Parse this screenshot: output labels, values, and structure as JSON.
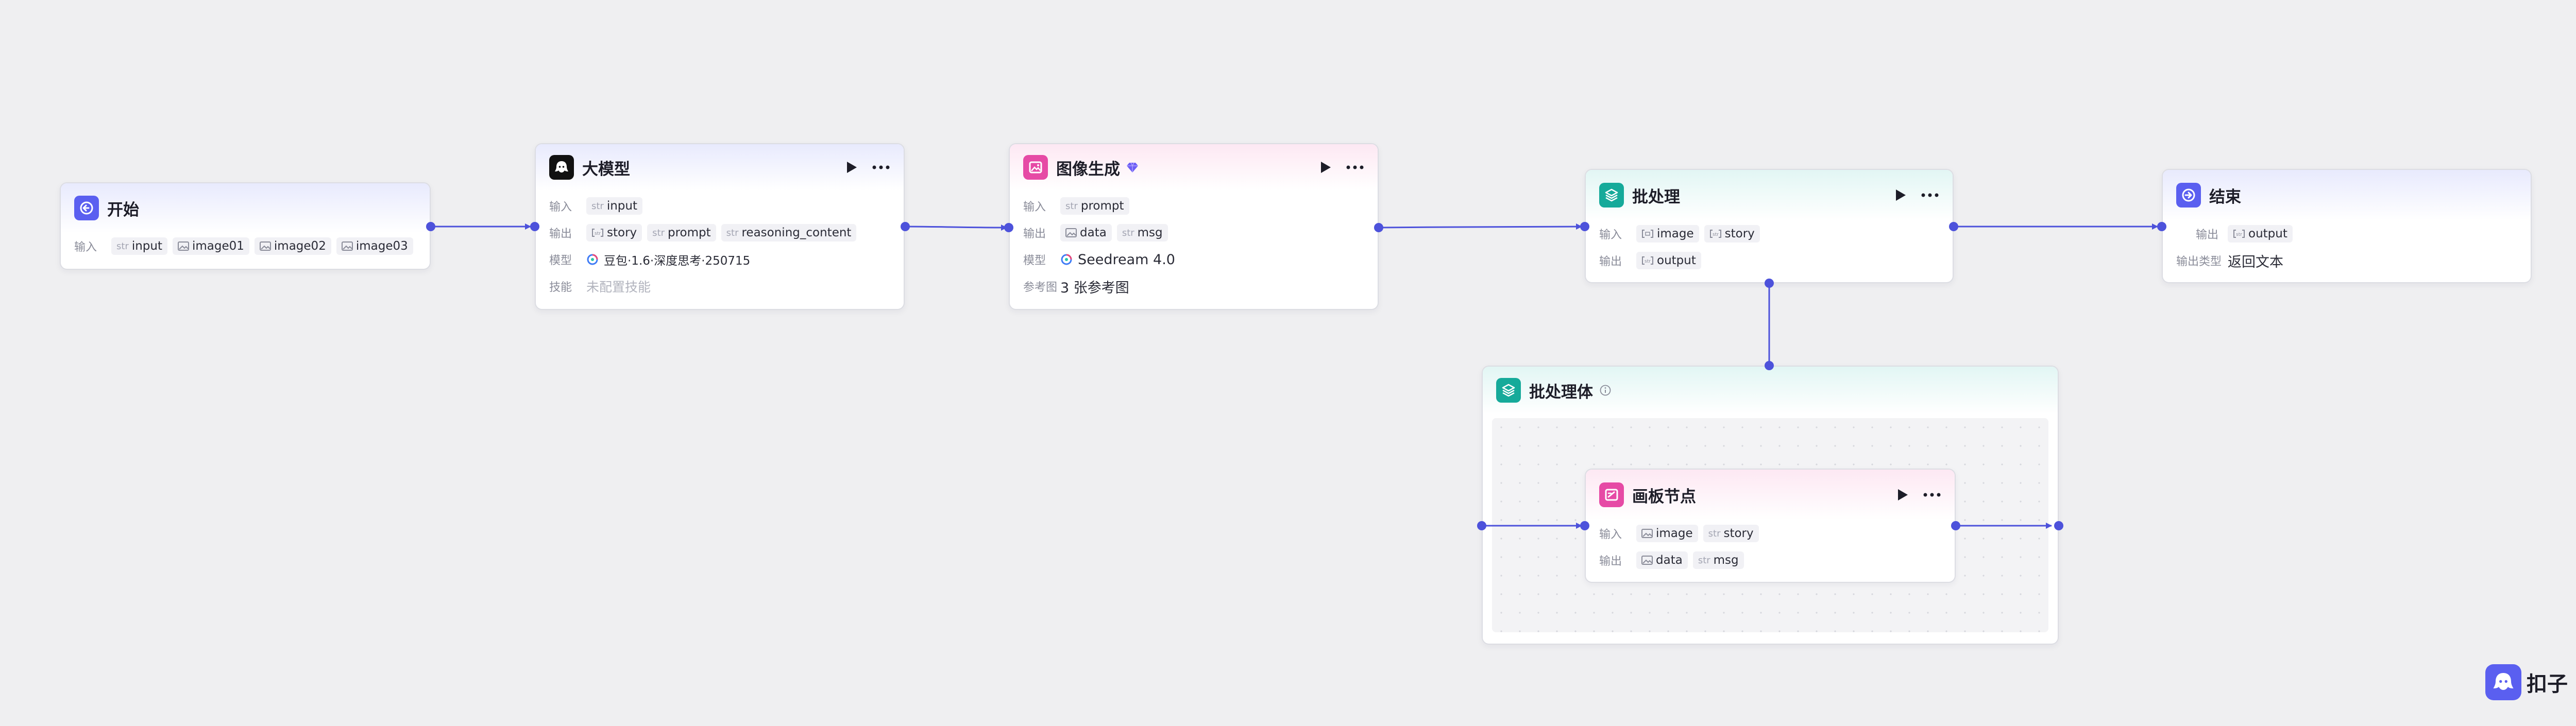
{
  "nodes": {
    "start": {
      "title": "开始",
      "input_label": "输入",
      "inputs": [
        {
          "type": "str",
          "name": "input"
        },
        {
          "type": "image",
          "name": "image01"
        },
        {
          "type": "image",
          "name": "image02"
        },
        {
          "type": "image",
          "name": "image03"
        }
      ]
    },
    "llm": {
      "title": "大模型",
      "input_label": "输入",
      "output_label": "输出",
      "model_label": "模型",
      "skill_label": "技能",
      "inputs": [
        {
          "type": "str",
          "name": "input"
        }
      ],
      "outputs": [
        {
          "type": "list",
          "name": "story"
        },
        {
          "type": "str",
          "name": "prompt"
        },
        {
          "type": "str",
          "name": "reasoning_content"
        }
      ],
      "model": "豆包·1.6·深度思考·250715",
      "skill": "未配置技能"
    },
    "image_gen": {
      "title": "图像生成",
      "input_label": "输入",
      "output_label": "输出",
      "model_label": "模型",
      "ref_label": "参考图",
      "inputs": [
        {
          "type": "str",
          "name": "prompt"
        }
      ],
      "outputs": [
        {
          "type": "image",
          "name": "data"
        },
        {
          "type": "str",
          "name": "msg"
        }
      ],
      "model": "Seedream 4.0",
      "ref_images": "3 张参考图"
    },
    "batch": {
      "title": "批处理",
      "input_label": "输入",
      "output_label": "输出",
      "inputs": [
        {
          "type": "list",
          "name": "image"
        },
        {
          "type": "list",
          "name": "story"
        }
      ],
      "outputs": [
        {
          "type": "list",
          "name": "output"
        }
      ]
    },
    "end": {
      "title": "结束",
      "output_label": "输出",
      "output_type_label": "输出类型",
      "outputs": [
        {
          "type": "list",
          "name": "output"
        }
      ],
      "output_type": "返回文本"
    },
    "batch_body": {
      "title": "批处理体"
    },
    "canvas": {
      "title": "画板节点",
      "input_label": "输入",
      "output_label": "输出",
      "inputs": [
        {
          "type": "image",
          "name": "image"
        },
        {
          "type": "str",
          "name": "story"
        }
      ],
      "outputs": [
        {
          "type": "image",
          "name": "data"
        },
        {
          "type": "str",
          "name": "msg"
        }
      ]
    }
  },
  "brand": {
    "name": "扣子",
    "accent": "#4d52db"
  },
  "icons": {
    "start": "start-arrow-icon",
    "llm": "bot-icon",
    "image_gen": "image-icon",
    "batch": "layers-icon",
    "end": "end-arrow-icon",
    "batch_body": "layers-icon",
    "canvas": "canvas-icon",
    "model_logo": "doubao-logo-icon",
    "run": "play-icon",
    "more": "more-icon",
    "premium": "diamond-icon",
    "info": "info-icon"
  }
}
